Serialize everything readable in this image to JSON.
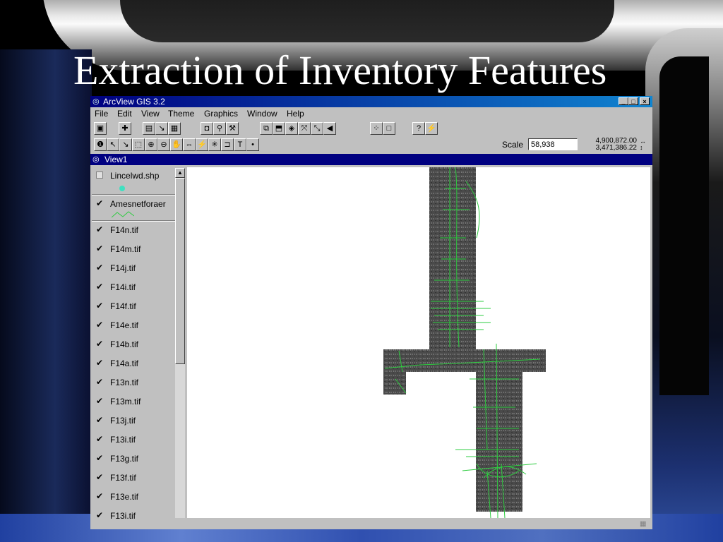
{
  "slide": {
    "title": "Extraction of Inventory Features"
  },
  "window": {
    "title": "ArcView GIS 3.2",
    "controls": {
      "minimize": "_",
      "maximize": "□",
      "close": "×"
    }
  },
  "menu": {
    "items": [
      {
        "label": "File"
      },
      {
        "label": "Edit"
      },
      {
        "label": "View"
      },
      {
        "label": "Theme"
      },
      {
        "label": "Graphics"
      },
      {
        "label": "Window"
      },
      {
        "label": "Help"
      }
    ]
  },
  "toolbar1": {
    "icons": [
      "save-icon",
      "add-theme-icon",
      "theme-properties-icon",
      "edit-legend-icon",
      "open-table-icon",
      "find-icon",
      "locate-address-icon",
      "query-builder-icon",
      "zoom-to-extent-icon",
      "zoom-to-themes-icon",
      "zoom-to-selected-icon",
      "zoom-in-icon",
      "zoom-out-icon",
      "zoom-previous-icon",
      "select-by-theme-icon",
      "clear-selection-icon",
      "help-icon",
      "hotlink-icon"
    ]
  },
  "toolbar2": {
    "icons": [
      "identify-icon",
      "pointer-icon",
      "vertex-edit-icon",
      "area-of-interest-icon",
      "zoom-in-tool-icon",
      "zoom-out-tool-icon",
      "pan-icon",
      "measure-icon",
      "hotlink-tool-icon",
      "label-icon",
      "text-tool-icon",
      "draw-point-icon"
    ],
    "scale_label": "Scale",
    "scale_value": "58,938",
    "coord_x": "4,900,872.00",
    "coord_y": "3,471,386.22"
  },
  "view": {
    "title": "View1"
  },
  "toc": {
    "layers": [
      {
        "name": "Lincelwd.shp",
        "checked": false
      },
      {
        "name": "Amesnetforaer",
        "checked": true
      },
      {
        "name": "F14n.tif",
        "checked": true
      },
      {
        "name": "F14m.tif",
        "checked": true
      },
      {
        "name": "F14j.tif",
        "checked": true
      },
      {
        "name": "F14i.tif",
        "checked": true
      },
      {
        "name": "F14f.tif",
        "checked": true
      },
      {
        "name": "F14e.tif",
        "checked": true
      },
      {
        "name": "F14b.tif",
        "checked": true
      },
      {
        "name": "F14a.tif",
        "checked": true
      },
      {
        "name": "F13n.tif",
        "checked": true
      },
      {
        "name": "F13m.tif",
        "checked": true
      },
      {
        "name": "F13j.tif",
        "checked": true
      },
      {
        "name": "F13i.tif",
        "checked": true
      },
      {
        "name": "F13g.tif",
        "checked": true
      },
      {
        "name": "F13f.tif",
        "checked": true
      },
      {
        "name": "F13e.tif",
        "checked": true
      },
      {
        "name": "F13i.tif",
        "checked": true
      }
    ]
  },
  "colors": {
    "title_bar": "#000080",
    "network_lines": "#2ecc40",
    "imagery": "#4a4a4a",
    "point_symbol": "#40e0c0"
  }
}
